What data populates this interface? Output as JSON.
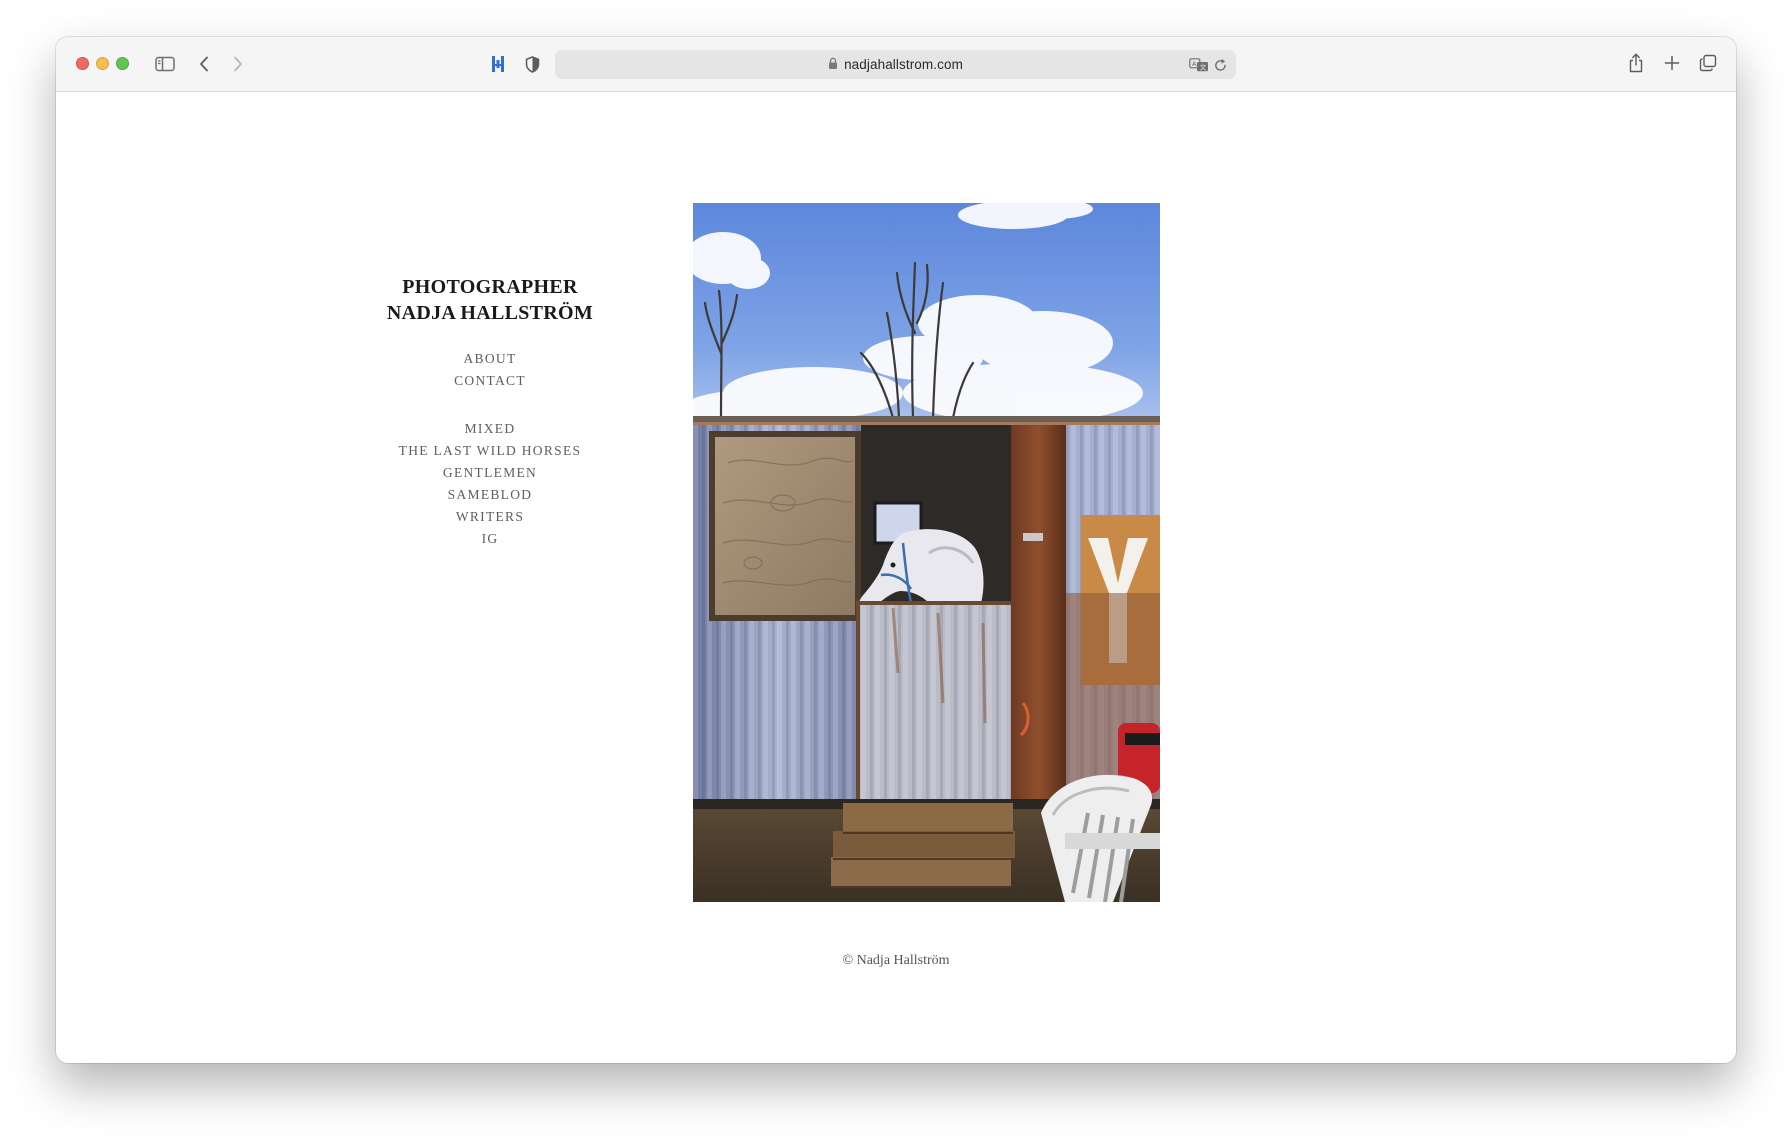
{
  "browser": {
    "url": "nadjahallstrom.com",
    "icons": {
      "sidebar": "sidebar-toggle-icon",
      "back": "chevron-left-icon",
      "forward": "chevron-right-icon",
      "extension1": "extension-icon",
      "privacy": "shield-icon",
      "lock": "lock-icon",
      "translate": "translate-icon",
      "reload": "reload-icon",
      "share": "share-icon",
      "new_tab": "plus-icon",
      "tabs": "tab-overview-icon"
    },
    "colors": {
      "traffic_red": "#ed6a5e",
      "traffic_yellow": "#f4bf4f",
      "traffic_green": "#61c554",
      "extension_blue": "#2f6fd6"
    }
  },
  "site": {
    "title_line1": "PHOTOGRAPHER",
    "title_line2": "NADJA HALLSTRÖM",
    "nav_primary": [
      "ABOUT",
      "CONTACT"
    ],
    "nav_projects": [
      "MIXED",
      "THE LAST WILD HORSES",
      "GENTLEMEN",
      "SAMEBLOD",
      "WRITERS",
      "IG"
    ],
    "footer": "© Nadja Hallström"
  }
}
